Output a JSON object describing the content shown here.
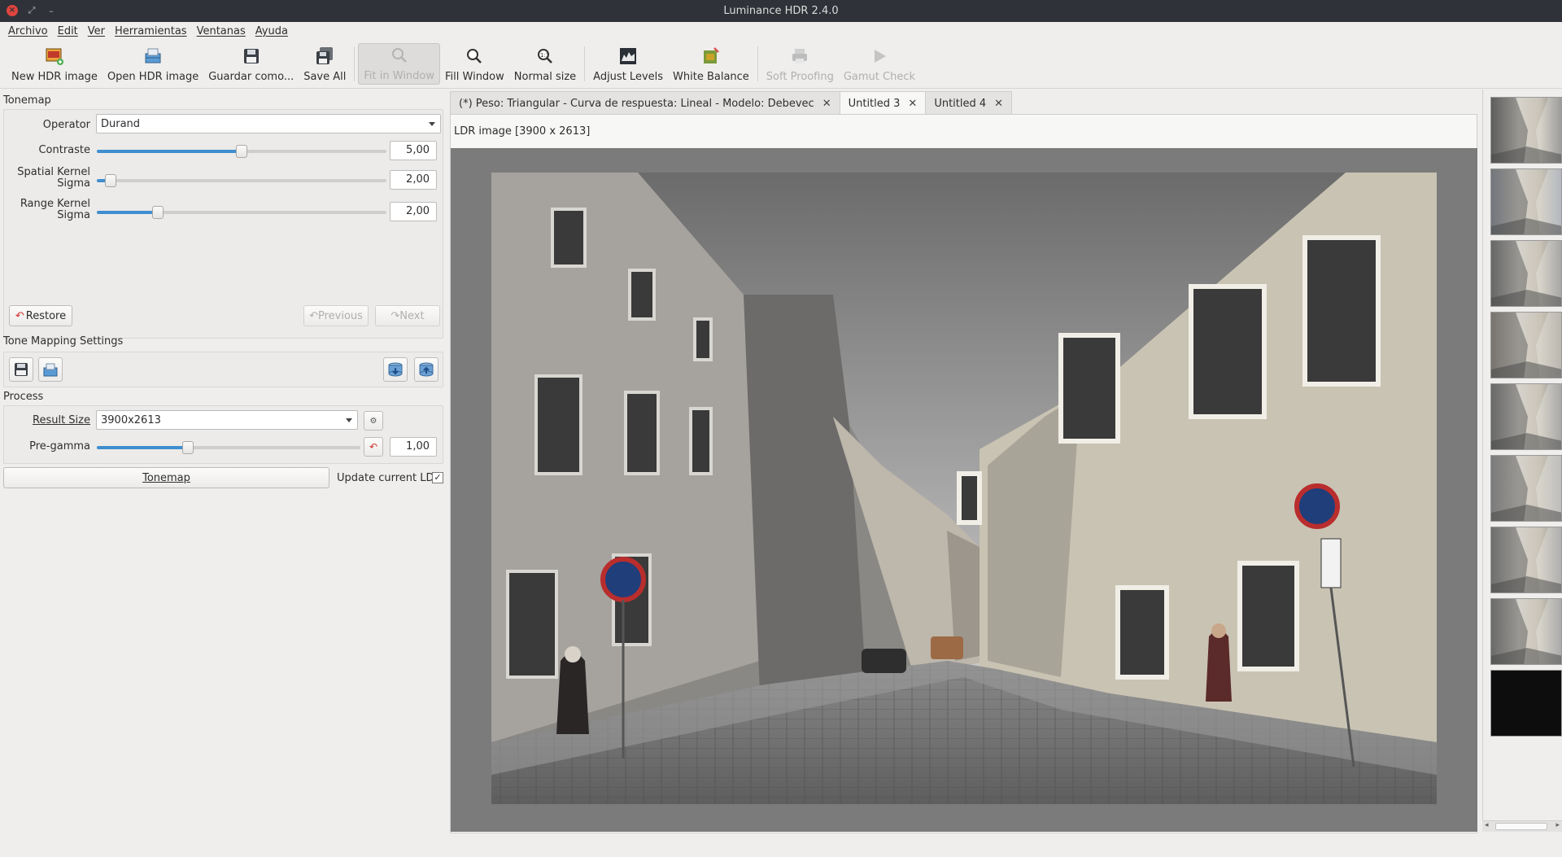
{
  "window": {
    "title": "Luminance HDR 2.4.0"
  },
  "menu": [
    "Archivo",
    "Edit",
    "Ver",
    "Herramientas",
    "Ventanas",
    "Ayuda"
  ],
  "toolbar": {
    "new_hdr": "New HDR image",
    "open_hdr": "Open HDR image",
    "save_as": "Guardar como...",
    "save_all": "Save All",
    "fit_window": "Fit in Window",
    "fill_window": "Fill Window",
    "normal_size": "Normal size",
    "adjust_levels": "Adjust Levels",
    "white_balance": "White Balance",
    "soft_proofing": "Soft Proofing",
    "gamut_check": "Gamut Check"
  },
  "tonemap": {
    "section": "Tonemap",
    "operator_label": "Operator",
    "operator_value": "Durand",
    "contrast_label": "Contraste",
    "contrast_value": "5,00",
    "contrast_fraction": 0.5,
    "spatial_label_1": "Spatial Kernel",
    "spatial_label_2": "Sigma",
    "spatial_value": "2,00",
    "spatial_fraction": 0.03,
    "range_label_1": "Range Kernel",
    "range_label_2": "Sigma",
    "range_value": "2,00",
    "range_fraction": 0.2,
    "restore": "Restore",
    "previous": "Previous",
    "next": "Next"
  },
  "settings": {
    "section": "Tone Mapping Settings"
  },
  "process": {
    "section": "Process",
    "result_size_label": "Result Size",
    "result_size_value": "3900x2613",
    "pregamma_label": "Pre-gamma",
    "pregamma_value": "1,00",
    "pregamma_fraction": 0.34,
    "tonemap_button": "Tonemap",
    "update_ldr_label": "Update current LDR",
    "update_ldr_checked": "✓"
  },
  "tabs": [
    {
      "label": "(*) Peso: Triangular - Curva de respuesta: Lineal - Modelo: Debevec",
      "close": "✕"
    },
    {
      "label": "Untitled 3",
      "close": "✕"
    },
    {
      "label": "Untitled 4",
      "close": "✕"
    }
  ],
  "viewer": {
    "image_info": "LDR image [3900 x 2613]"
  },
  "colors": {
    "accent": "#3f8ecf",
    "titlebar": "#2f3238",
    "viewer_bg": "#7b7b7b"
  }
}
